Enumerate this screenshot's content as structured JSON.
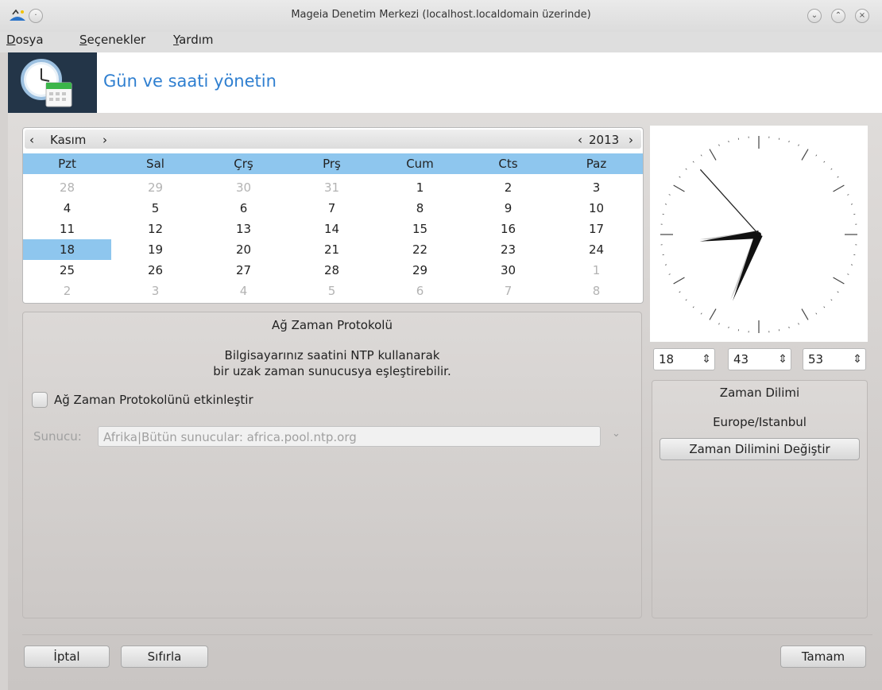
{
  "window": {
    "title": "Mageia Denetim Merkezi  (localhost.localdomain üzerinde)"
  },
  "menu": [
    {
      "label": "Dosya",
      "mnemonic": "D",
      "rest": "osya"
    },
    {
      "label": "Seçenekler",
      "mnemonic": "S",
      "rest": "eçenekler"
    },
    {
      "label": "Yardım",
      "mnemonic": "Y",
      "rest": "ardım"
    }
  ],
  "banner": {
    "title": "Gün ve saati yönetin"
  },
  "calendar": {
    "month": "Kasım",
    "year": "2013",
    "weekdays": [
      "Pzt",
      "Sal",
      "Çrş",
      "Prş",
      "Cum",
      "Cts",
      "Paz"
    ],
    "selected_day": "18",
    "weeks": [
      [
        {
          "d": "28",
          "dim": true
        },
        {
          "d": "29",
          "dim": true
        },
        {
          "d": "30",
          "dim": true
        },
        {
          "d": "31",
          "dim": true
        },
        {
          "d": "1"
        },
        {
          "d": "2"
        },
        {
          "d": "3"
        }
      ],
      [
        {
          "d": "4"
        },
        {
          "d": "5"
        },
        {
          "d": "6"
        },
        {
          "d": "7"
        },
        {
          "d": "8"
        },
        {
          "d": "9"
        },
        {
          "d": "10"
        }
      ],
      [
        {
          "d": "11"
        },
        {
          "d": "12"
        },
        {
          "d": "13"
        },
        {
          "d": "14"
        },
        {
          "d": "15"
        },
        {
          "d": "16"
        },
        {
          "d": "17"
        }
      ],
      [
        {
          "d": "18",
          "sel": true
        },
        {
          "d": "19"
        },
        {
          "d": "20"
        },
        {
          "d": "21"
        },
        {
          "d": "22"
        },
        {
          "d": "23"
        },
        {
          "d": "24"
        }
      ],
      [
        {
          "d": "25"
        },
        {
          "d": "26"
        },
        {
          "d": "27"
        },
        {
          "d": "28"
        },
        {
          "d": "29"
        },
        {
          "d": "30"
        },
        {
          "d": "1",
          "dim": true
        }
      ],
      [
        {
          "d": "2",
          "dim": true
        },
        {
          "d": "3",
          "dim": true
        },
        {
          "d": "4",
          "dim": true
        },
        {
          "d": "5",
          "dim": true
        },
        {
          "d": "6",
          "dim": true
        },
        {
          "d": "7",
          "dim": true
        },
        {
          "d": "8",
          "dim": true
        }
      ]
    ]
  },
  "ntp": {
    "title": "Ağ Zaman Protokolü",
    "description_line1": "Bilgisayarınız saatini NTP kullanarak",
    "description_line2": "bir uzak zaman sunucusya eşleştirebilir.",
    "enable_label": "Ağ Zaman Protokolünü etkinleştir",
    "enabled": false,
    "server_label": "Sunucu:",
    "server_value": "Afrika|Bütün sunucular: africa.pool.ntp.org"
  },
  "time": {
    "hour": "18",
    "minute": "43",
    "second": "53"
  },
  "timezone": {
    "title": "Zaman Dilimi",
    "value": "Europe/Istanbul",
    "change_button": "Zaman Dilimini Değiştir"
  },
  "buttons": {
    "cancel": "İptal",
    "reset": "Sıfırla",
    "ok": "Tamam"
  },
  "icons": {
    "app": "mageia-icon",
    "window_min": "minimize-icon",
    "window_max": "maximize-icon",
    "window_close": "close-icon",
    "banner": "clock-calendar-icon"
  }
}
